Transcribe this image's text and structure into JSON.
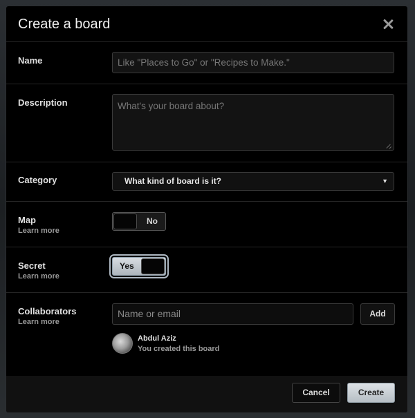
{
  "dialog": {
    "title": "Create a board",
    "close_icon": "close-icon"
  },
  "name": {
    "label": "Name",
    "placeholder": "Like \"Places to Go\" or \"Recipes to Make.\""
  },
  "description": {
    "label": "Description",
    "placeholder": "What's your board about?"
  },
  "category": {
    "label": "Category",
    "selected": "What kind of board is it?",
    "arrow": "▼"
  },
  "map": {
    "label": "Map",
    "learn_more": "Learn more",
    "toggle_text": "No",
    "enabled": false
  },
  "secret": {
    "label": "Secret",
    "learn_more": "Learn more",
    "toggle_text": "Yes",
    "enabled": true
  },
  "collaborators": {
    "label": "Collaborators",
    "learn_more": "Learn more",
    "input_placeholder": "Name or email",
    "add_label": "Add",
    "members": [
      {
        "name": "Abdul Aziz",
        "note": "You created this board"
      }
    ]
  },
  "footer": {
    "cancel_label": "Cancel",
    "create_label": "Create"
  },
  "colors": {
    "modal_bg": "#000000",
    "border": "#262626",
    "primary_button": "#c9d0d5"
  }
}
